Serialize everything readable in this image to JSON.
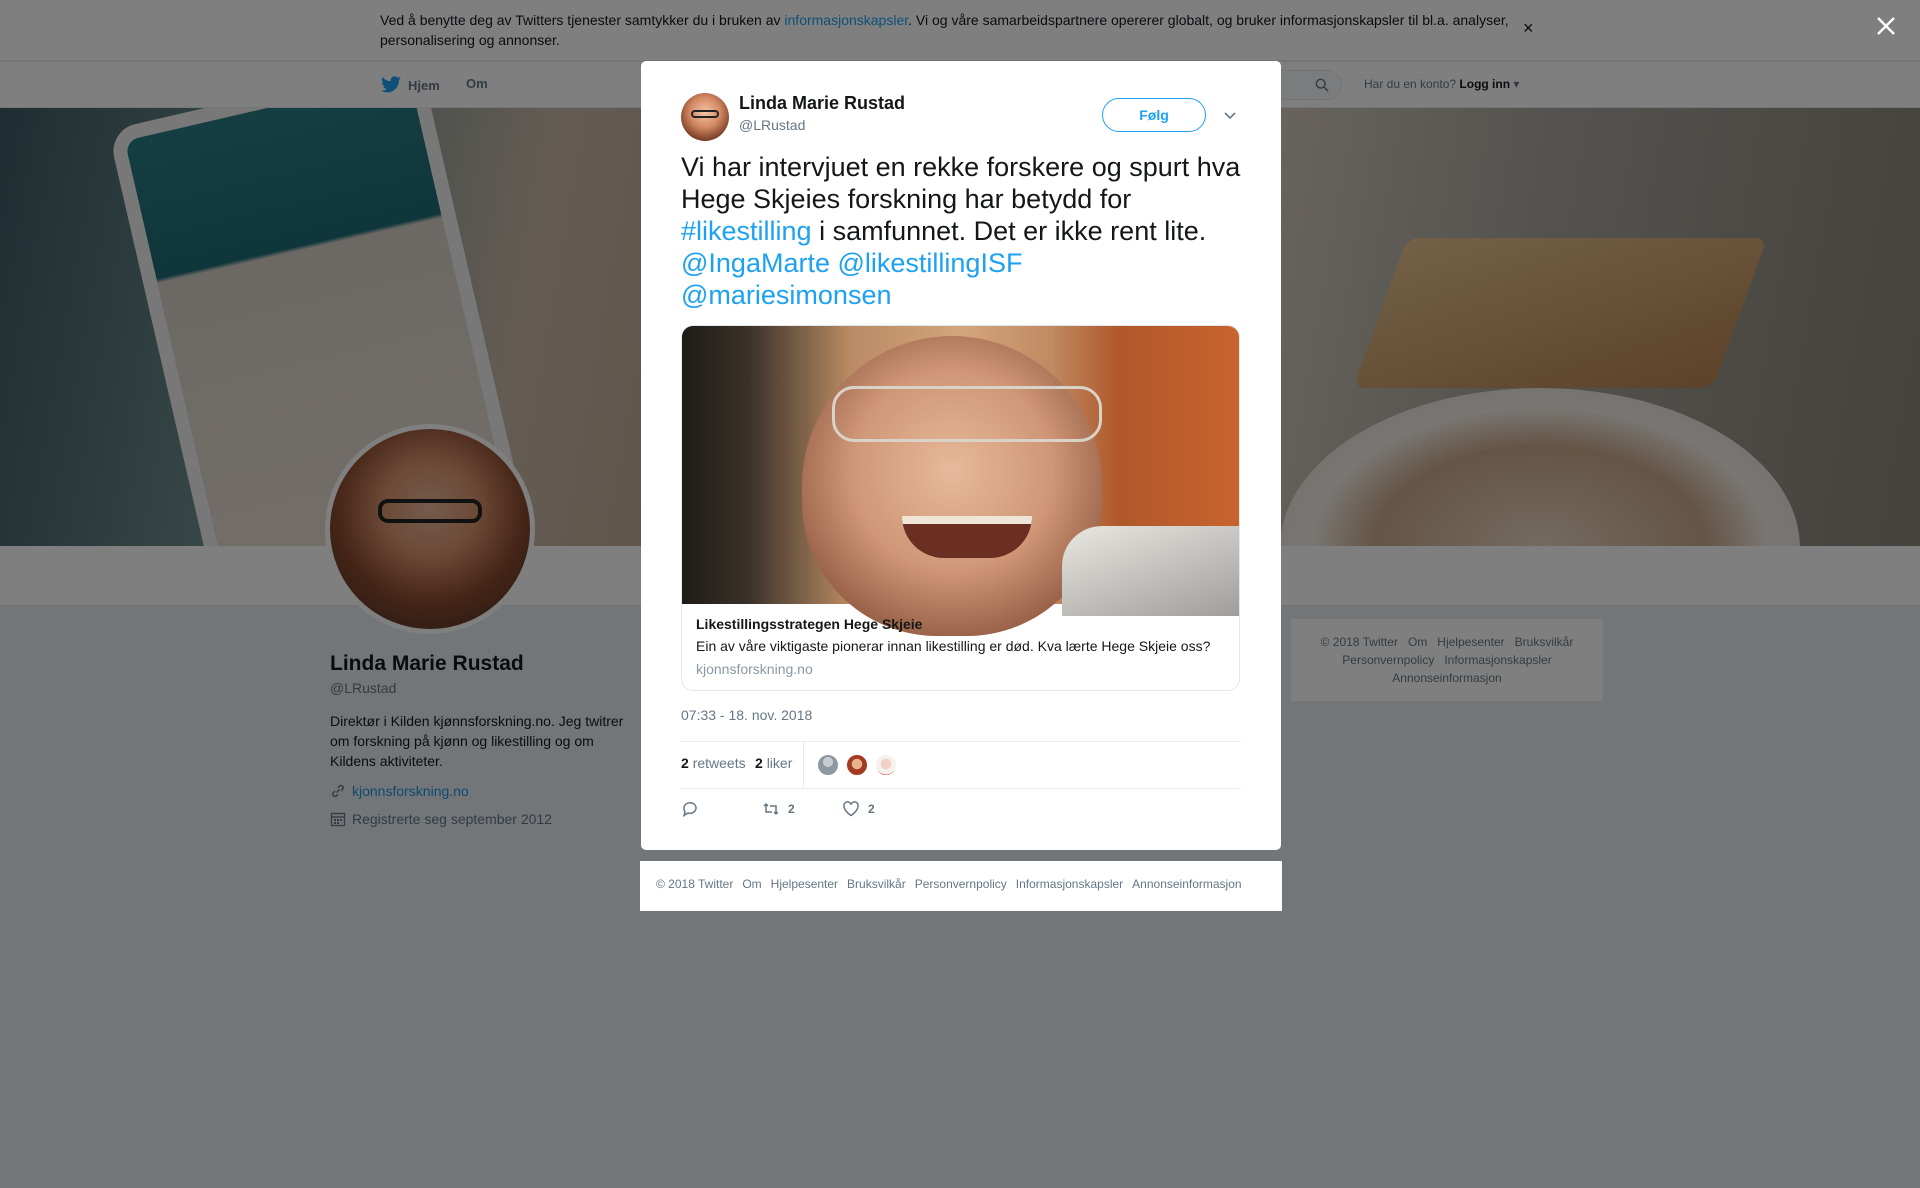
{
  "cookie_bar": {
    "text_before": "Ved å benytte deg av Twitters tjenester samtykker du i bruken av ",
    "link": "informasjonskapsler",
    "text_after": ". Vi og våre samarbeidspartnere opererer globalt, og bruker informasjonskapsler til bl.a. analyser, personalisering og annonser.",
    "close": "×"
  },
  "nav": {
    "home": "Hjem",
    "about": "Om",
    "login_prompt": "Har du en konto?",
    "login": "Logg inn"
  },
  "profile": {
    "name": "Linda Marie Rustad",
    "handle": "@LRustad",
    "bio": "Direktør i Kilden kjønnsforskning.no. Jeg twitrer om forskning på kjønn og likestilling og om Kildens aktiviteter.",
    "website": "kjonnsforskning.no",
    "joined": "Registrerte seg september 2012"
  },
  "side_footer": {
    "links": [
      "© 2018 Twitter",
      "Om",
      "Hjelpesenter",
      "Bruksvilkår",
      "Personvernpolicy",
      "Informasjonskapsler",
      "Annonseinformasjon"
    ]
  },
  "tweet": {
    "author_name": "Linda Marie Rustad",
    "author_handle": "@LRustad",
    "follow_label": "Følg",
    "text_part1": "Vi har intervjuet en rekke forskere og spurt hva Hege Skjeies forskning har betydd for ",
    "hashtag": "#likestilling",
    "text_part2": " i samfunnet. Det er ikke rent lite.",
    "mention1": "@IngaMarte",
    "mention2": "@likestillingISF",
    "mention3": "@mariesimonsen",
    "card": {
      "title": "Likestillingsstrategen Hege Skjeie",
      "description": "Ein av våre viktigaste pionerar innan likestilling er død. Kva lærte Hege Skjeie oss?",
      "domain": "kjonnsforskning.no"
    },
    "timestamp": "07:33 - 18. nov. 2018",
    "retweets_count": "2",
    "retweets_label": "retweets",
    "likes_count": "2",
    "likes_label": "liker",
    "action_retweet_count": "2",
    "action_like_count": "2"
  },
  "modal_footer": {
    "links": [
      "© 2018 Twitter",
      "Om",
      "Hjelpesenter",
      "Bruksvilkår",
      "Personvernpolicy",
      "Informasjonskapsler",
      "Annonseinformasjon"
    ]
  },
  "colors": {
    "accent": "#1da1f2",
    "overlay": "rgba(0,0,0,0.5)"
  }
}
